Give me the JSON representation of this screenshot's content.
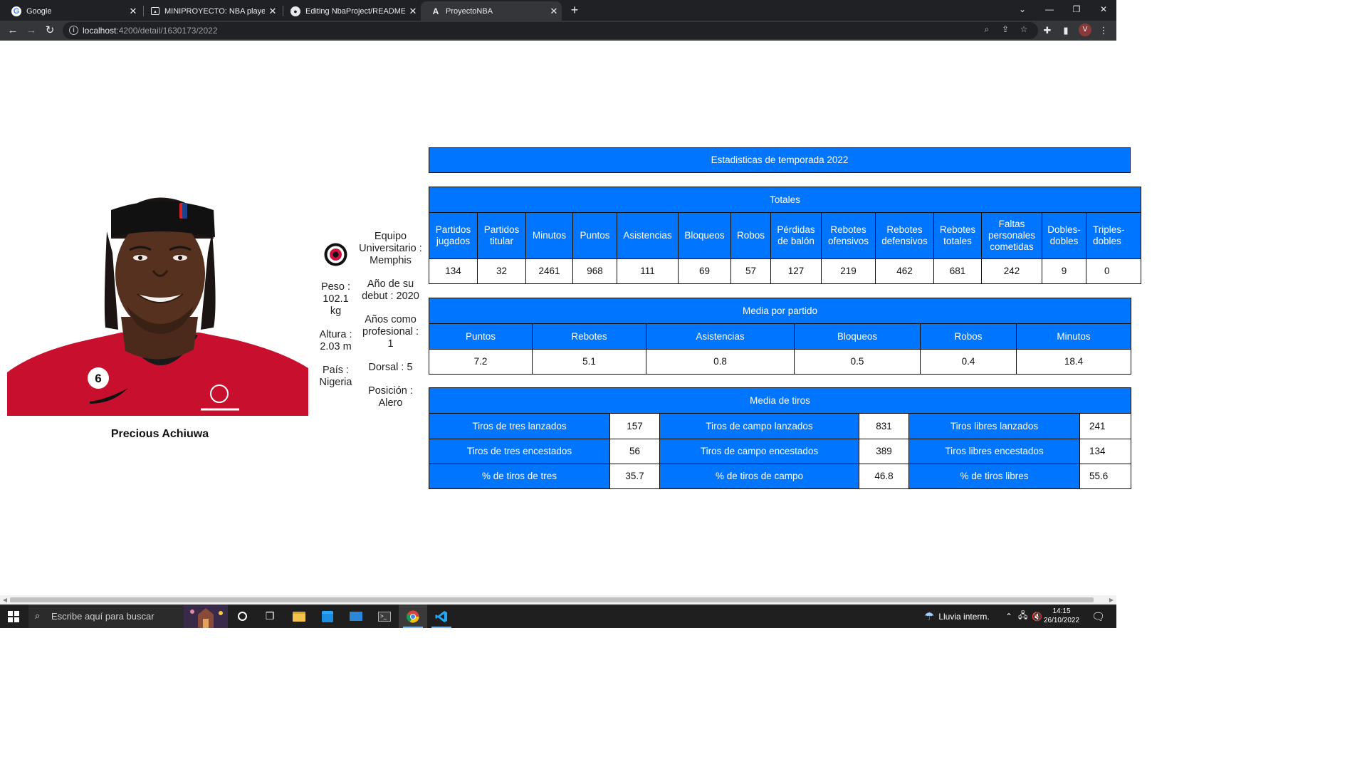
{
  "browser": {
    "tabs": [
      {
        "title": "Google",
        "favicon": "google-icon"
      },
      {
        "title": "MINIPROYECTO: NBA players and",
        "favicon": "image-icon"
      },
      {
        "title": "Editing NbaProject/README.md",
        "favicon": "github-icon"
      },
      {
        "title": "ProyectoNBA",
        "favicon": "angular-icon"
      }
    ],
    "url_host": "localhost",
    "url_path": ":4200/detail/1630173/2022"
  },
  "player": {
    "name": "Precious Achiuwa",
    "weight": "Peso : 102.1 kg",
    "height": "Altura : 2.03 m",
    "country": "País : Nigeria",
    "college": "Equipo Universitario : Memphis",
    "debut": "Año de su debut : 2020",
    "years_pro": "Años como profesional : 1",
    "jersey": "Dorsal : 5",
    "position": "Posición : Alero"
  },
  "season_title": "Estadisticas de temporada 2022",
  "totals": {
    "title": "Totales",
    "headers": [
      "Partidos jugados",
      "Partidos titular",
      "Minutos",
      "Puntos",
      "Asistencias",
      "Bloqueos",
      "Robos",
      "Pérdidas de balón",
      "Rebotes ofensivos",
      "Rebotes defensivos",
      "Rebotes totales",
      "Faltas personales cometidas",
      "Dobles-dobles",
      "Triples-dobles"
    ],
    "values": [
      "134",
      "32",
      "2461",
      "968",
      "111",
      "69",
      "57",
      "127",
      "219",
      "462",
      "681",
      "242",
      "9",
      "0"
    ]
  },
  "averages": {
    "title": "Media por partido",
    "headers": [
      "Puntos",
      "Rebotes",
      "Asistencias",
      "Bloqueos",
      "Robos",
      "Minutos"
    ],
    "values": [
      "7.2",
      "5.1",
      "0.8",
      "0.5",
      "0.4",
      "18.4"
    ]
  },
  "shooting": {
    "title": "Media de tiros",
    "rows": [
      [
        {
          "label": "Tiros de tres lanzados",
          "value": "157"
        },
        {
          "label": "Tiros de campo lanzados",
          "value": "831"
        },
        {
          "label": "Tiros libres lanzados",
          "value": "241"
        }
      ],
      [
        {
          "label": "Tiros de tres encestados",
          "value": "56"
        },
        {
          "label": "Tiros de campo encestados",
          "value": "389"
        },
        {
          "label": "Tiros libres encestados",
          "value": "134"
        }
      ],
      [
        {
          "label": "% de tiros de tres",
          "value": "35.7"
        },
        {
          "label": "% de tiros de campo",
          "value": "46.8"
        },
        {
          "label": "% de tiros libres",
          "value": "55.6"
        }
      ]
    ]
  },
  "taskbar": {
    "search_placeholder": "Escribe aquí para buscar",
    "weather": "Lluvia interm.",
    "time": "14:15",
    "date": "26/10/2022"
  },
  "colors": {
    "table_header_bg": "#0075ff",
    "jersey_red": "#c8102e"
  }
}
